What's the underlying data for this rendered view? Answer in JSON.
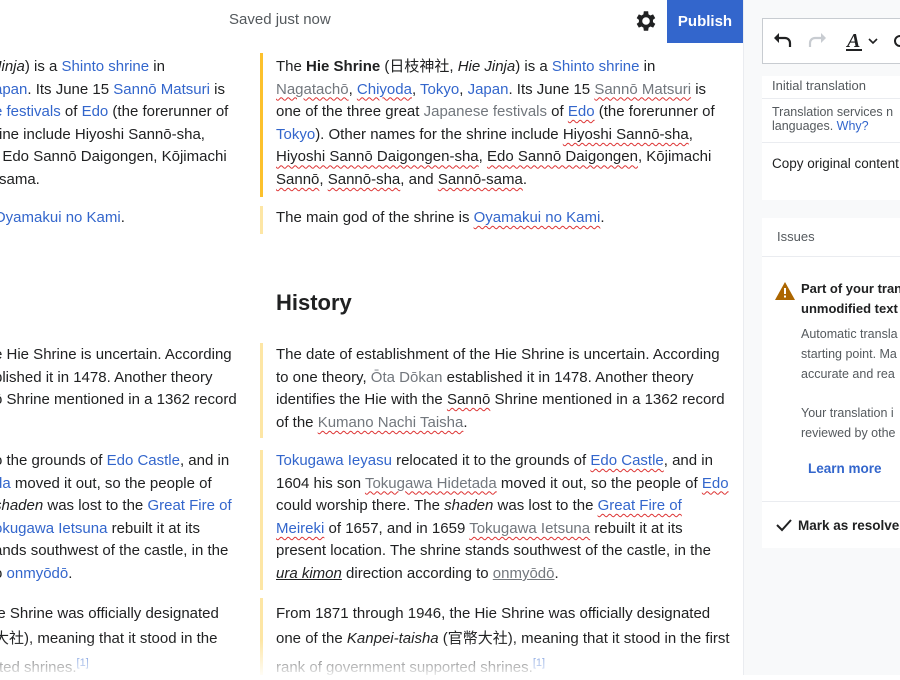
{
  "header": {
    "saved_status": "Saved just now",
    "publish_label": "Publish"
  },
  "source": {
    "p1": {
      "jinja": "Jinja",
      "a": ") is a ",
      "shinto": "Shinto shrine",
      "b": " in",
      "japan": "apan",
      "c": ". Its June 15 ",
      "matsuri": "Sannō Matsuri",
      "d": " is",
      "festivals": "e festivals",
      "e": " of ",
      "edo": "Edo",
      "f": " (the forerunner of",
      "g": "rine include Hiyoshi Sannō-sha,",
      "h": ", Edo Sannō Daigongen, Kōjimachi",
      "i": "-sama."
    },
    "p2": {
      "kami": "Oyamakui no Kami",
      "a": "."
    },
    "p3": {
      "l1": "e Hie Shrine is uncertain. According",
      "l2": "blished it in 1478. Another theory",
      "l3": "ō Shrine mentioned in a 1362 record"
    },
    "p4": {
      "a": "o the grounds of ",
      "castle": "Edo Castle",
      "b": ", and in",
      "da": "da",
      "c": " moved it out, so the people of",
      "shaden": "shaden",
      "d": " was lost to the ",
      "fire": "Great Fire of",
      "tokugawa": "okugawa Ietsuna",
      "e": " rebuilt it at its",
      "f": "ands southwest of the castle, in the",
      "g": "o ",
      "onmyodo": "onmyōdō",
      "h": "."
    },
    "p5": {
      "l1": "ie Shrine  was officially designated",
      "l2": "大社), meaning that it stood in the",
      "l3": "rted shrines.",
      "ref": "[1]"
    }
  },
  "target": {
    "p1": {
      "a": "The ",
      "name": "Hie Shrine",
      "b": " (日枝神社, ",
      "hiejinja": "Hie Jinja",
      "c": ") is a ",
      "shinto": "Shinto shrine",
      "d": " in",
      "nagatacho": "Nagatachō",
      "e": ", ",
      "chiyoda": "Chiyoda",
      "f": ", ",
      "tokyo1": "Tokyo",
      "g": ", ",
      "japan": "Japan",
      "h": ". Its June 15 ",
      "matsuri": "Sannō Matsuri",
      "i": " is",
      "j": "one of the three great ",
      "festivals": "Japanese festivals",
      "k": " of ",
      "edo": "Edo",
      "l": " (the forerunner of",
      "tokyo2": "Tokyo",
      "m": "). Other names for the shrine include ",
      "hs1": "Hiyoshi Sannō-sha",
      "n": ",",
      "hs2": "Hiyoshi Sannō Daigongen-sha",
      "o": ", ",
      "eds": "Edo Sannō Daigongen",
      "p": ", Kōjimachi",
      "s1": "Sannō",
      "q": ", ",
      "s2": "Sannō-sha",
      "r": ", and ",
      "s3": "Sannō-sama",
      "s": "."
    },
    "p2": {
      "a": "The main god of the shrine is ",
      "kami": "Oyamakui no Kami",
      "b": "."
    },
    "heading": "History",
    "p3": {
      "a": "The date of establishment of the Hie Shrine is uncertain. According to one theory, ",
      "dokan": "Ōta Dōkan",
      "b": " established it in 1478. Another theory identifies the Hie with the ",
      "sanno": "Sannō",
      "c": " Shrine mentioned in a 1362 record of the ",
      "kumano": "Kumano Nachi Taisha",
      "d": "."
    },
    "p4": {
      "ieyasu": "Tokugawa Ieyasu",
      "a": " relocated it to the grounds of ",
      "castle": "Edo Castle",
      "b": ", and in 1604 his son ",
      "hidetada": "Tokugawa Hidetada",
      "c": " moved it out, so the people of ",
      "edo": "Edo",
      "d": " could worship there. The ",
      "shaden": "shaden",
      "e": " was lost to the ",
      "fire": "Great Fire of Meireki",
      "f": " of 1657, and in 1659 ",
      "ietsuna": "Tokugawa Ietsuna",
      "g": " rebuilt it at its present location. The shrine stands southwest of the castle, in the ",
      "urakimon": "ura kimon",
      "h": " direction according to ",
      "onmyodo": "onmyōdō",
      "i": "."
    },
    "p5": {
      "a": "From 1871 through 1946, the Hie Shrine  was officially designated one of the ",
      "kanpei": "Kanpei-taisha",
      "b": " (官幣大社), meaning that it stood in the first rank of government supported shrines.",
      "ref": "[1]"
    }
  },
  "sidebar": {
    "initial_translation": "Initial translation",
    "services_text": "Translation services n",
    "languages_text": "languages.",
    "why_link": "Why?",
    "copy_original": "Copy original content",
    "issues_label": "Issues",
    "issue_title_1": "Part of your tran",
    "issue_title_2": "unmodified text",
    "issue_body_1": "Automatic transla",
    "issue_body_2": "starting point. Ma",
    "issue_body_3": "accurate and rea",
    "issue_body2_1": "Your translation i",
    "issue_body2_2": "reviewed by othe",
    "learn_more": "Learn more",
    "mark_resolved": "Mark as resolved"
  },
  "icons": [
    "gear-icon",
    "undo-icon",
    "redo-icon",
    "text-style-icon",
    "chevron-down-icon",
    "warning-icon",
    "checkmark-icon"
  ],
  "colors": {
    "accent": "#3366cc",
    "warning": "#ac6600",
    "bar_active": "#fcc12d",
    "bar": "#fde6a5"
  }
}
